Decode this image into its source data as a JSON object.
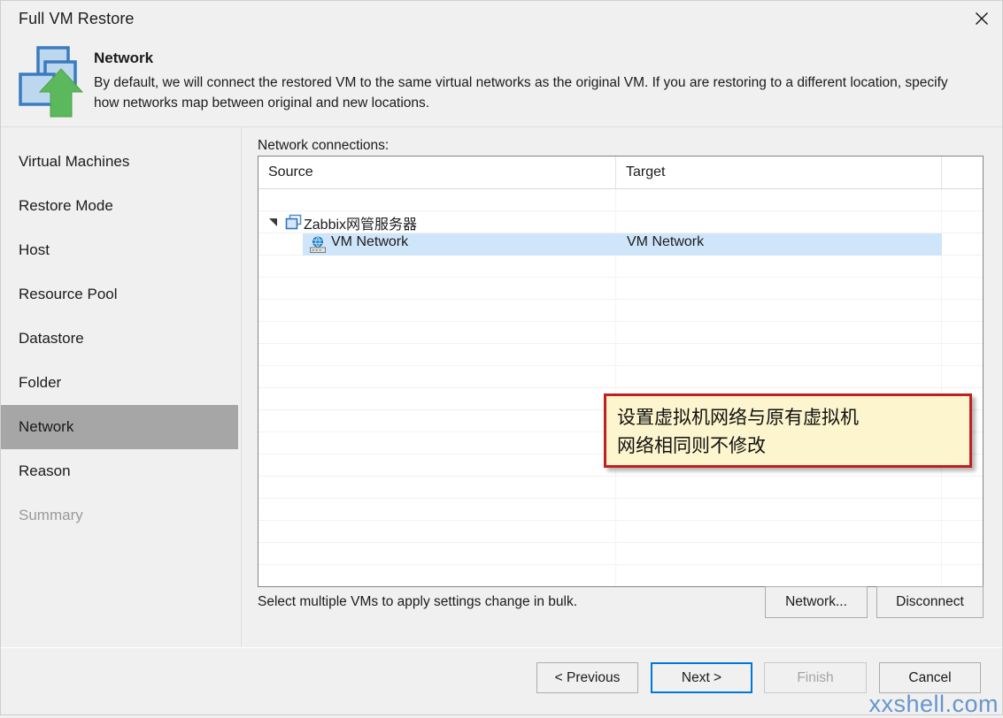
{
  "window": {
    "title": "Full VM Restore",
    "close_icon": "close-icon"
  },
  "banner": {
    "icon": "vm-restore-icon",
    "title": "Network",
    "description": "By default, we will connect the restored VM to the same virtual networks as the original VM. If you are restoring to a different location, specify how networks map between original and new locations."
  },
  "sidebar": {
    "items": [
      {
        "label": "Virtual Machines",
        "state": "normal"
      },
      {
        "label": "Restore Mode",
        "state": "normal"
      },
      {
        "label": "Host",
        "state": "normal"
      },
      {
        "label": "Resource Pool",
        "state": "normal"
      },
      {
        "label": "Datastore",
        "state": "normal"
      },
      {
        "label": "Folder",
        "state": "normal"
      },
      {
        "label": "Network",
        "state": "selected"
      },
      {
        "label": "Reason",
        "state": "normal"
      },
      {
        "label": "Summary",
        "state": "disabled"
      }
    ]
  },
  "main": {
    "list_label": "Network connections:",
    "columns": [
      "Source",
      "Target",
      ""
    ],
    "rows": [
      {
        "type": "vm-group",
        "icon": "vm-icon",
        "expander": "expand-triangle-icon",
        "source": "Zabbix网管服务器",
        "target": ""
      },
      {
        "type": "network-mapping",
        "icon": "network-icon",
        "source": "VM Network",
        "target": "VM Network",
        "selected": true
      }
    ],
    "bulk_hint": "Select multiple VMs to apply settings change in bulk.",
    "network_button": "Network...",
    "disconnect_button": "Disconnect"
  },
  "callout": {
    "text": "设置虚拟机网络与原有虚拟机\n网络相同则不修改",
    "fill_color": "#fcf5cd",
    "border_color": "#c0201f"
  },
  "footer": {
    "previous": "< Previous",
    "next": "Next >",
    "finish": "Finish",
    "cancel": "Cancel"
  },
  "watermark": {
    "text": "xxshell.com",
    "color": "#5b8fc9"
  }
}
